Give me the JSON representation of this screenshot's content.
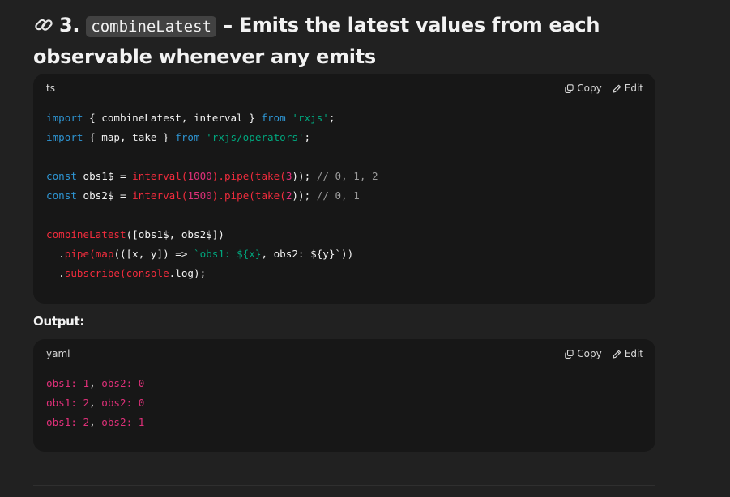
{
  "heading": {
    "emoji_icon": "link-icon",
    "number": "3.",
    "code": "combineLatest",
    "dash_text": "– Emits the latest values from each observable whenever ",
    "emphasis": "any",
    "tail": " emits"
  },
  "code_block_1": {
    "language": "ts",
    "copy_label": "Copy",
    "edit_label": "Edit",
    "lines": {
      "l1_import": "import",
      "l1_body": " { combineLatest, interval } ",
      "l1_from": "from",
      "l1_str": "'rxjs'",
      "l1_end": ";",
      "l2_import": "import",
      "l2_body": " { map, take } ",
      "l2_from": "from",
      "l2_str": "'rxjs/operators'",
      "l2_end": ";",
      "l4_const": "const",
      "l4_name": " obs1$ = ",
      "l4_fn": "interval",
      "l4_p1": "(",
      "l4_n1": "1000",
      "l4_p2": ").",
      "l4_pipe": "pipe",
      "l4_p3": "(",
      "l4_take": "take",
      "l4_p4": "(",
      "l4_n2": "3",
      "l4_p5": ")); ",
      "l4_com": "// 0, 1, 2",
      "l5_const": "const",
      "l5_name": " obs2$ = ",
      "l5_fn": "interval",
      "l5_p1": "(",
      "l5_n1": "1500",
      "l5_p2": ").",
      "l5_pipe": "pipe",
      "l5_p3": "(",
      "l5_take": "take",
      "l5_p4": "(",
      "l5_n2": "2",
      "l5_p5": ")); ",
      "l5_com": "// 0, 1",
      "l7_fn": "combineLatest",
      "l7_rest": "([obs1$, obs2$])",
      "l8_pre": "  .",
      "l8_pipe": "pipe",
      "l8_p1": "(",
      "l8_map": "map",
      "l8_p2": "(([x, y]) => ",
      "l8_str1": "`obs1: ",
      "l8_tpl1": "${x}",
      "l8_mid": ", obs2: ${y}`",
      "l8_end": "))",
      "l9_pre": "  .",
      "l9_sub": "subscribe",
      "l9_p1": "(",
      "l9_console": "console",
      "l9_rest": ".log);"
    }
  },
  "output_label": "Output:",
  "code_block_2": {
    "language": "yaml",
    "copy_label": "Copy",
    "edit_label": "Edit",
    "lines": [
      {
        "k1": "obs1",
        "v1": ": 1",
        "sep": ",",
        "k2": " obs2",
        "v2": ": 0"
      },
      {
        "k1": "obs1",
        "v1": ": 2",
        "sep": ",",
        "k2": " obs2",
        "v2": ": 0"
      },
      {
        "k1": "obs1",
        "v1": ": 2",
        "sep": ",",
        "k2": " obs2",
        "v2": ": 1"
      }
    ]
  },
  "colors": {
    "background": "#212121",
    "code_background": "#171717",
    "keyword": "#2e95d3",
    "string": "#00a67d",
    "number": "#df3079",
    "function": "#f22c3d",
    "comment": "#9a9a9a"
  }
}
